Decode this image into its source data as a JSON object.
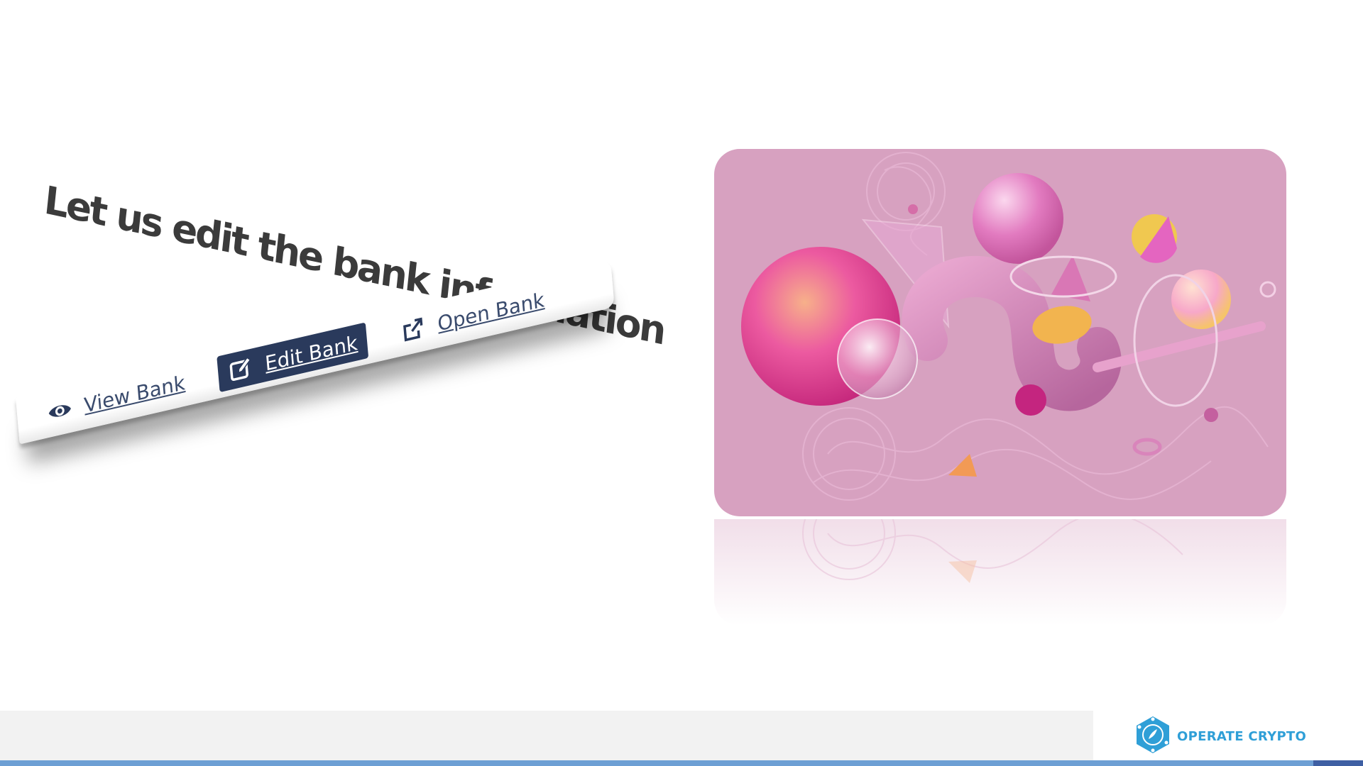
{
  "slide": {
    "heading": "Let us edit the bank information"
  },
  "toolbar": {
    "items": [
      {
        "label": "View Bank",
        "icon": "eye-icon",
        "active": false
      },
      {
        "label": "Edit Bank",
        "icon": "edit-icon",
        "active": true
      },
      {
        "label": "Open Bank",
        "icon": "external-link-icon",
        "active": false
      }
    ]
  },
  "footer": {
    "logo_text": "OPERATE CRYPTO"
  },
  "colors": {
    "accent_dark": "#2a3a5c",
    "card_pink": "#d7a1c0",
    "logo_blue": "#2f9fd7",
    "stripe_blue": "#6d9fd4"
  }
}
